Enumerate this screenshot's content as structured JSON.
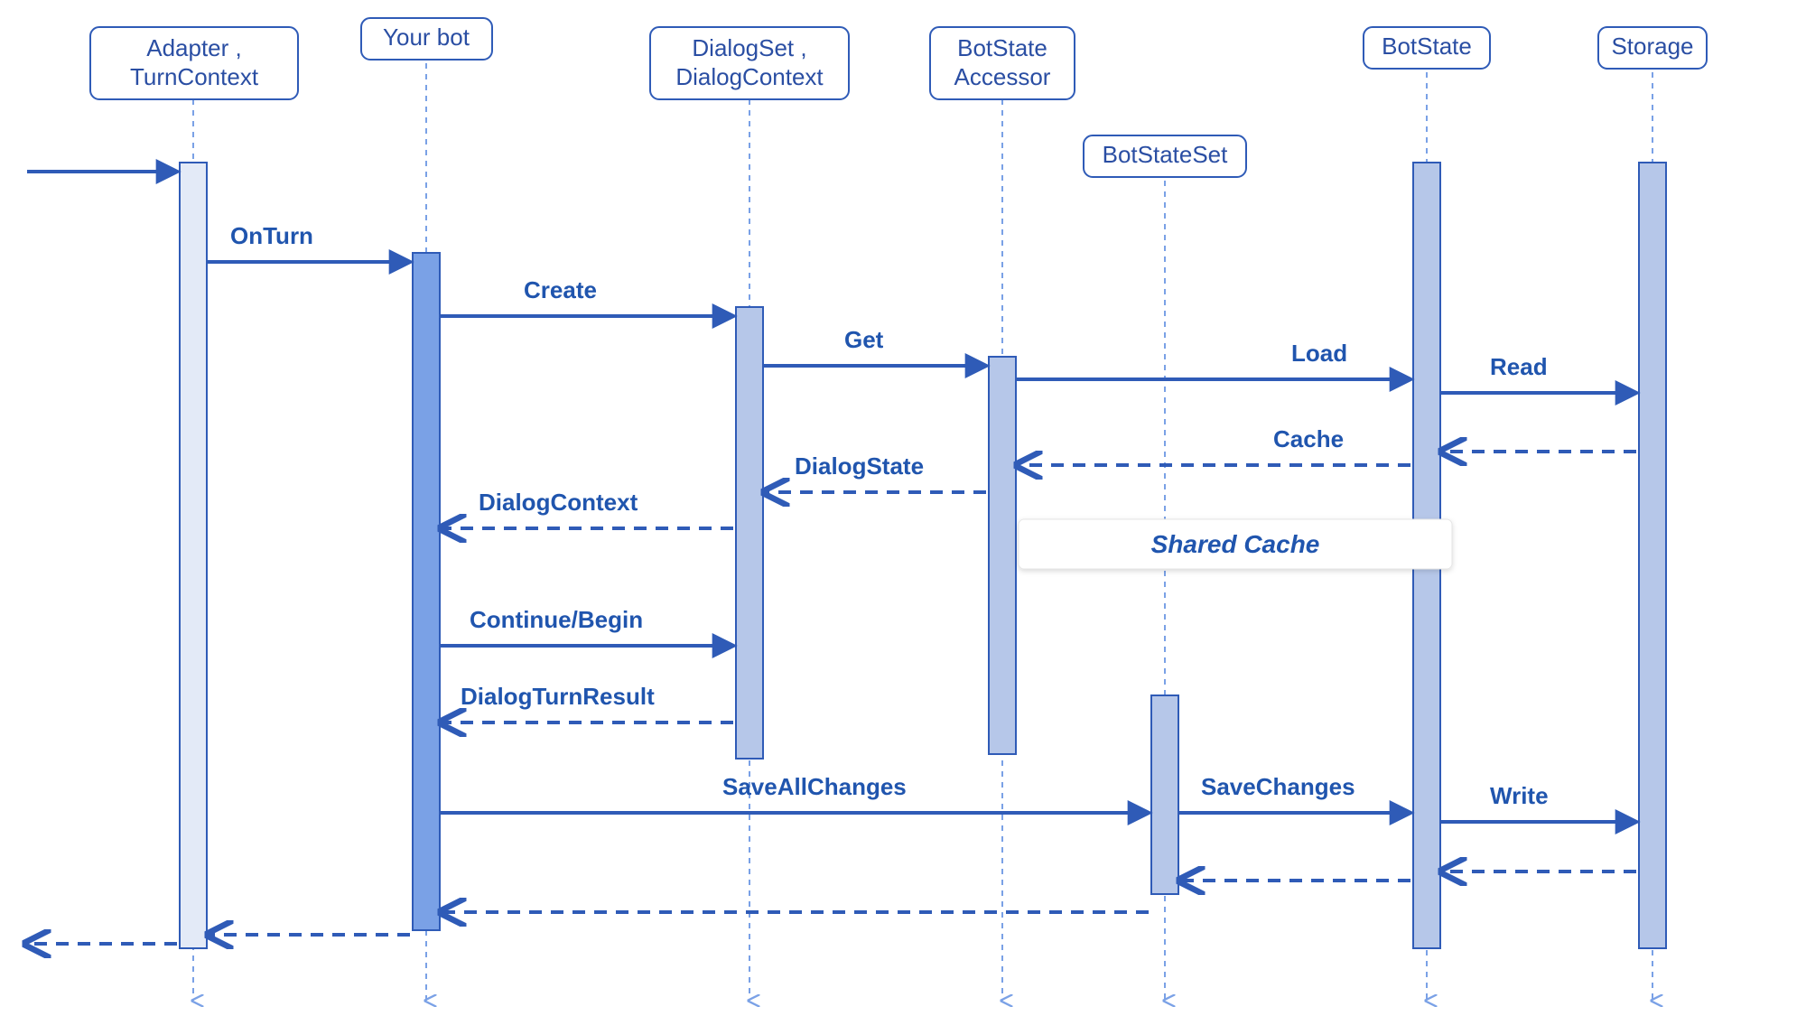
{
  "participants": {
    "adapter": {
      "label1": "Adapter ,",
      "label2": "TurnContext"
    },
    "yourbot": {
      "label1": "Your bot"
    },
    "dialog": {
      "label1": "DialogSet ,",
      "label2": "DialogContext"
    },
    "accessor": {
      "label1": "BotState",
      "label2": "Accessor"
    },
    "stateset": {
      "label1": "BotStateSet"
    },
    "botstate": {
      "label1": "BotState"
    },
    "storage": {
      "label1": "Storage"
    }
  },
  "messages": {
    "onturn": "OnTurn",
    "create": "Create",
    "get": "Get",
    "load": "Load",
    "read": "Read",
    "cache": "Cache",
    "dialogstate": "DialogState",
    "dialogcontext": "DialogContext",
    "continuebegin": "Continue/Begin",
    "dialogturnresult": "DialogTurnResult",
    "saveallchanges": "SaveAllChanges",
    "savechanges": "SaveChanges",
    "write": "Write"
  },
  "annotations": {
    "sharedcache": "Shared Cache"
  }
}
